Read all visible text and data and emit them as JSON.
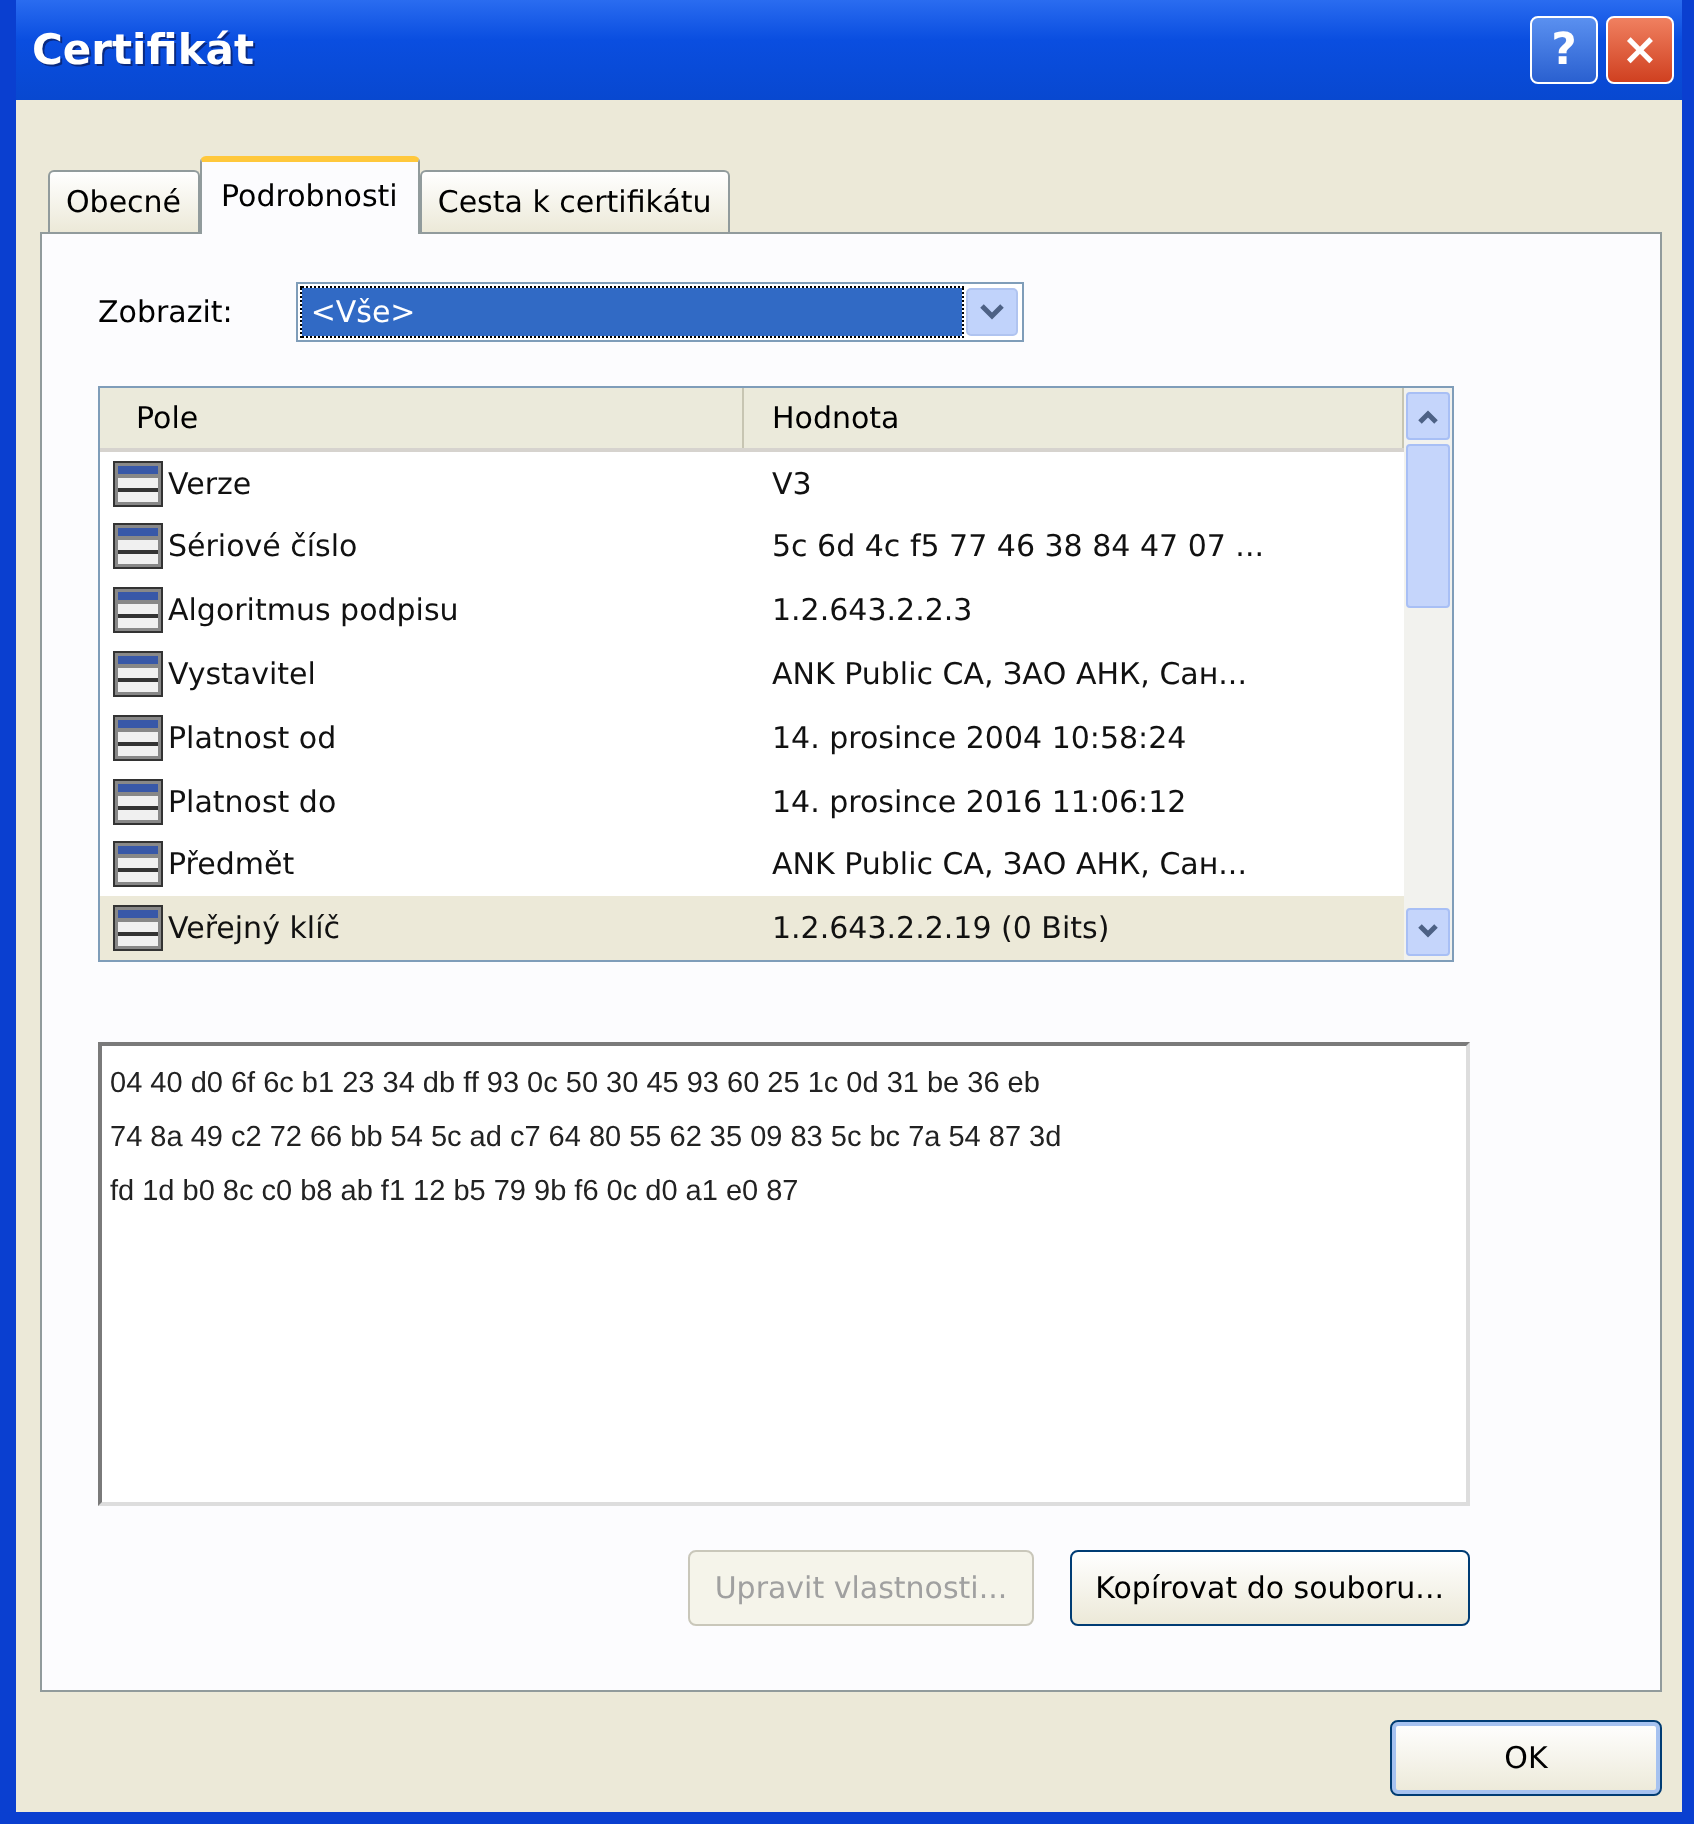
{
  "window": {
    "title": "Certifikát",
    "buttons": [
      "?",
      "×"
    ]
  },
  "tabs": [
    {
      "label": "Obecné",
      "selected": false
    },
    {
      "label": "Podrobnosti",
      "selected": true
    },
    {
      "label": "Cesta k certifikátu",
      "selected": false
    }
  ],
  "show": {
    "label": "Zobrazit:",
    "value": "<Vše>"
  },
  "table": {
    "columns": [
      "Pole",
      "Hodnota"
    ],
    "rows": [
      {
        "field": "Verze",
        "value": "V3",
        "selected": false
      },
      {
        "field": "Sériové číslo",
        "value": "5c 6d 4c f5 77 46 38 84 47 07 ...",
        "selected": false
      },
      {
        "field": "Algoritmus podpisu",
        "value": "1.2.643.2.2.3",
        "selected": false
      },
      {
        "field": "Vystavitel",
        "value": "ANK Public CA, ЗАО АНК, Сан...",
        "selected": false
      },
      {
        "field": "Platnost od",
        "value": "14. prosince 2004 10:58:24",
        "selected": false
      },
      {
        "field": "Platnost do",
        "value": "14. prosince 2016 11:06:12",
        "selected": false
      },
      {
        "field": "Předmět",
        "value": "ANK Public CA, ЗАО АНК, Сан...",
        "selected": false
      },
      {
        "field": "Veřejný klíč",
        "value": "1.2.643.2.2.19 (0 Bits)",
        "selected": true
      }
    ]
  },
  "detail": [
    "04 40 d0 6f 6c b1 23 34 db ff 93 0c 50 30 45 93 60 25 1c 0d 31 be 36 eb",
    "74 8a 49 c2 72 66 bb 54 5c ad c7 64 80 55 62 35 09 83 5c bc 7a 54 87 3d",
    "fd 1d b0 8c c0 b8 ab f1 12 b5 79 9b f6 0c d0 a1 e0 87"
  ],
  "actions": [
    {
      "label": "Upravit vlastnosti...",
      "disabled": true
    },
    {
      "label": "Kopírovat do souboru...",
      "disabled": false
    }
  ],
  "footer": {
    "ok": "OK"
  }
}
